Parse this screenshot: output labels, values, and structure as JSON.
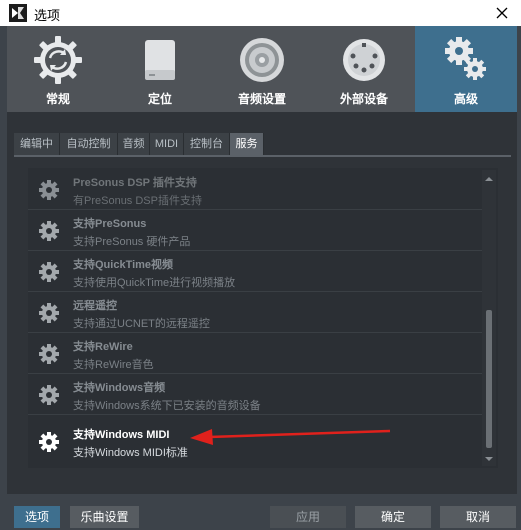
{
  "window": {
    "title": "选项"
  },
  "categories": [
    {
      "label": "常规",
      "icon": "sync-icon",
      "active": false
    },
    {
      "label": "定位",
      "icon": "drive-icon",
      "active": false
    },
    {
      "label": "音频设置",
      "icon": "speaker-icon",
      "active": false
    },
    {
      "label": "外部设备",
      "icon": "midi-port-icon",
      "active": false
    },
    {
      "label": "高级",
      "icon": "gears-icon",
      "active": true
    }
  ],
  "tabs": [
    {
      "label": "编辑中",
      "active": false
    },
    {
      "label": "自动控制",
      "active": false
    },
    {
      "label": "音频",
      "active": false
    },
    {
      "label": "MIDI",
      "active": false
    },
    {
      "label": "控制台",
      "active": false
    },
    {
      "label": "服务",
      "active": true
    }
  ],
  "services": [
    {
      "name": "PreSonus DSP 插件支持",
      "desc": "有PreSonus DSP插件支持",
      "state": "dim"
    },
    {
      "name": "支持PreSonus",
      "desc": "支持PreSonus 硬件产品",
      "state": "normal"
    },
    {
      "name": "支持QuickTime视频",
      "desc": "支持使用QuickTime进行视频播放",
      "state": "normal"
    },
    {
      "name": "远程遥控",
      "desc": "支持通过UCNET的远程遥控",
      "state": "normal"
    },
    {
      "name": "支持ReWire",
      "desc": "支持ReWire音色",
      "state": "normal"
    },
    {
      "name": "支持Windows音频",
      "desc": "支持Windows系统下已安装的音频设备",
      "state": "normal"
    },
    {
      "name": "支持Windows MIDI",
      "desc": "支持Windows MIDI标准",
      "state": "enabled"
    }
  ],
  "buttons": {
    "options": "选项",
    "song_settings": "乐曲设置",
    "apply": "应用",
    "ok": "确定",
    "cancel": "取消"
  },
  "colors": {
    "accent": "#3e6f8e",
    "annotation_arrow": "#e0211c"
  }
}
